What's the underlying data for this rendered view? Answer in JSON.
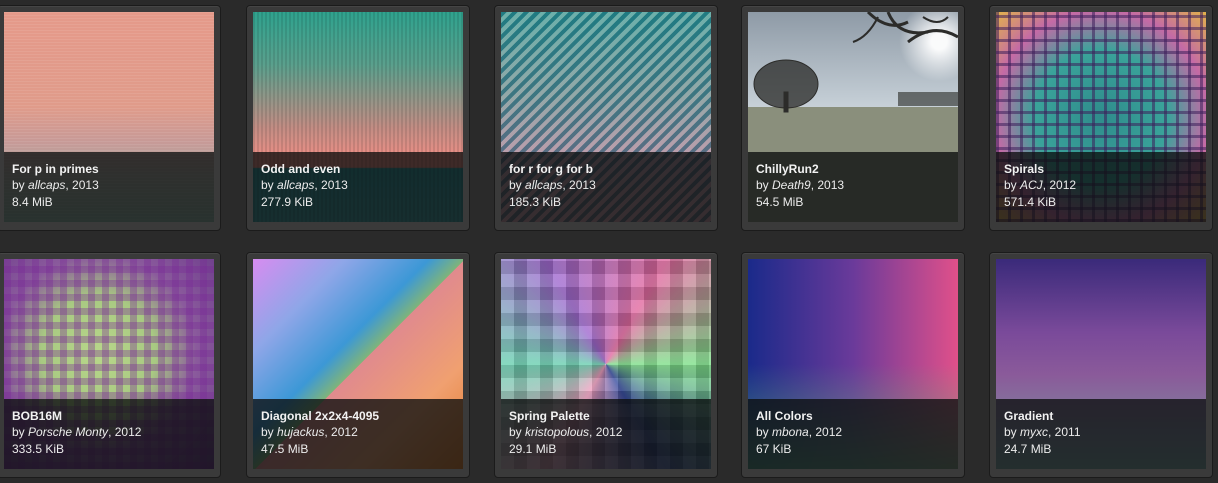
{
  "gallery": {
    "items": [
      {
        "title": "For p in primes",
        "by_prefix": "by ",
        "author": "allcaps",
        "year_suffix": ", 2013",
        "size": "8.4 MiB"
      },
      {
        "title": "Odd and even",
        "by_prefix": "by ",
        "author": "allcaps",
        "year_suffix": ", 2013",
        "size": "277.9 KiB"
      },
      {
        "title": "for r for g for b",
        "by_prefix": "by ",
        "author": "allcaps",
        "year_suffix": ", 2013",
        "size": "185.3 KiB"
      },
      {
        "title": "ChillyRun2",
        "by_prefix": "by ",
        "author": "Death9",
        "year_suffix": ", 2013",
        "size": "54.5 MiB"
      },
      {
        "title": "Spirals",
        "by_prefix": "by ",
        "author": "ACJ",
        "year_suffix": ", 2012",
        "size": "571.4 KiB"
      },
      {
        "title": "BOB16M",
        "by_prefix": "by ",
        "author": "Porsche Monty",
        "year_suffix": ", 2012",
        "size": "333.5 KiB"
      },
      {
        "title": "Diagonal 2x2x4-4095",
        "by_prefix": "by ",
        "author": "hujackus",
        "year_suffix": ", 2012",
        "size": "47.5 MiB"
      },
      {
        "title": "Spring Palette",
        "by_prefix": "by ",
        "author": "kristopolous",
        "year_suffix": ", 2012",
        "size": "29.1 MiB"
      },
      {
        "title": "All Colors",
        "by_prefix": "by ",
        "author": "mbona",
        "year_suffix": ", 2012",
        "size": "67 KiB"
      },
      {
        "title": "Gradient",
        "by_prefix": "by ",
        "author": "myxc",
        "year_suffix": ", 2011",
        "size": "24.7 MiB"
      }
    ]
  },
  "colors": {
    "page_background": "#2a2a2a",
    "card_background": "#3a3a3a",
    "overlay": "rgba(12,14,14,0.78)",
    "text": "#f2f2f2"
  }
}
